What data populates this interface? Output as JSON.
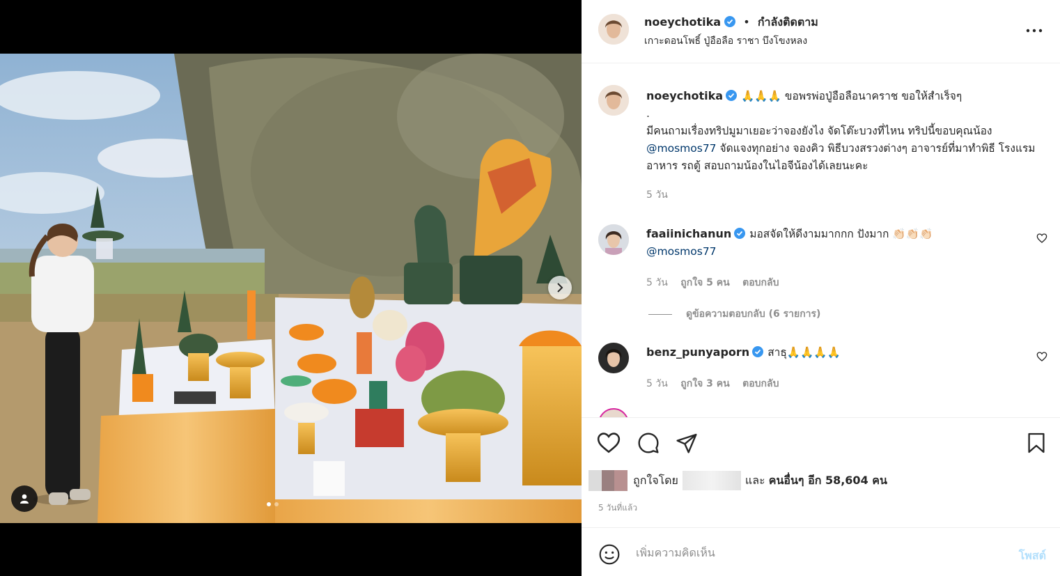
{
  "post": {
    "username": "noeychotika",
    "follow_status": "กำลังติดตาม",
    "location": "เกาะดอนโพธิ์ ปู่อือลือ ราชา บึงโขงหลง",
    "more_icon": "more-horizontal-icon"
  },
  "caption": {
    "username": "noeychotika",
    "line1": "🙏🙏🙏 ขอพรพ่อปู่อือลือนาคราช ขอให้สำเร็จๆ",
    "line2": ".",
    "text_a": "มีคนถามเรื่องทริปมูมาเยอะว่าจองยังไง จัดโต๊ะบวงที่ไหน ทริปนี้ขอบคุณน้อง",
    "mention": "@mosmos77",
    "text_b": "จัดแจงทุกอย่าง จองคิว พิธีบวงสรวงต่างๆ อาจารย์ที่มาทำพิธี โรงแรม อาหาร รถตู้ สอบถามน้องในไอจีน้องได้เลยนะคะ",
    "time": "5 วัน"
  },
  "comments": [
    {
      "username": "faaiinichanun",
      "text": "มอสจัดให้ดีงามมากกก ปังมาก 👏🏻👏🏻👏🏻",
      "mention": "@mosmos77",
      "time": "5 วัน",
      "likes": "ถูกใจ 5 คน",
      "reply": "ตอบกลับ"
    },
    {
      "username": "benz_punyaporn",
      "text": "สาธุ🙏🙏🙏🙏",
      "time": "5 วัน",
      "likes": "ถูกใจ 3 คน",
      "reply": "ตอบกลับ"
    }
  ],
  "view_replies": "ดูข้อความตอบกลับ (6 รายการ)",
  "likes": {
    "liked_by": "ถูกใจโดย",
    "and": "และ",
    "others": "คนอื่นๆ อีก 58,604 คน"
  },
  "time_ago": "5 วันที่แล้ว",
  "add_comment": {
    "placeholder": "เพิ่มความคิดเห็น",
    "post_label": "โพสต์"
  },
  "colors": {
    "verified": "#3897f0",
    "link": "#00376b",
    "post_button_disabled": "#b2dffc"
  }
}
